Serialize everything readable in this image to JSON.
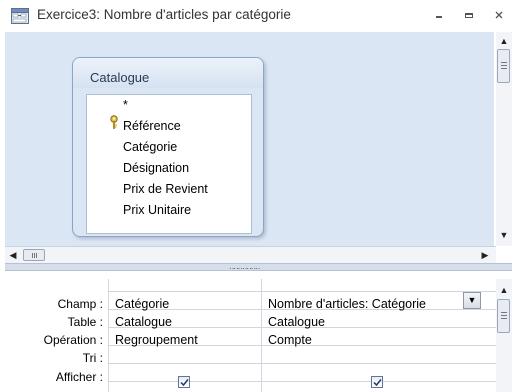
{
  "window": {
    "title": "Exercice3: Nombre d'articles par catégorie",
    "minimize_icon": "minimize-icon",
    "restore_icon": "restore-icon",
    "close_icon": "close-icon"
  },
  "table_box": {
    "name": "Catalogue",
    "fields": [
      "*",
      "Référence",
      "Catégorie",
      "Désignation",
      "Prix de Revient",
      "Prix Unitaire"
    ],
    "primary_key_field": "Référence"
  },
  "grid": {
    "row_labels": [
      "Champ :",
      "Table :",
      "Opération :",
      "Tri :",
      "Afficher :"
    ],
    "columns": [
      {
        "champ": "Catégorie",
        "table": "Catalogue",
        "operation": "Regroupement",
        "tri": "",
        "afficher": true
      },
      {
        "champ": "Nombre d'articles: Catégorie",
        "table": "Catalogue",
        "operation": "Compte",
        "tri": "",
        "afficher": true
      }
    ]
  },
  "colors": {
    "design_background": "#dbe6f4",
    "table_border": "#8ea4c3"
  }
}
